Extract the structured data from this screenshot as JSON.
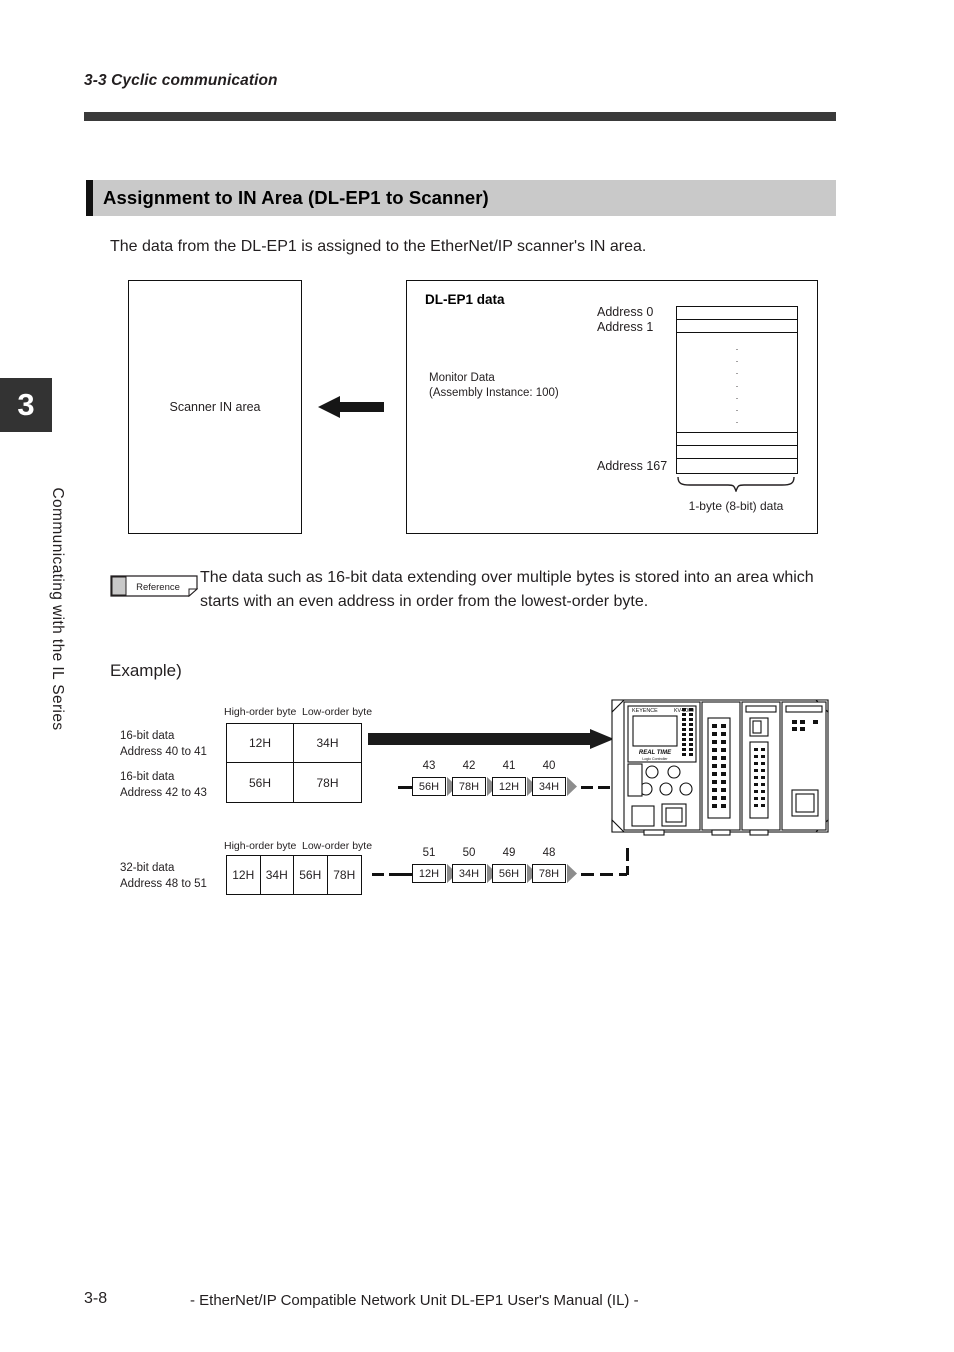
{
  "header": {
    "running_head": "3-3 Cyclic communication"
  },
  "sidebar": {
    "chapter_number": "3",
    "chapter_label": "Communicating with the IL Series"
  },
  "section": {
    "title": "Assignment to IN Area (DL-EP1 to Scanner)",
    "intro": "The data from the DL-EP1 is assigned to the EtherNet/IP scanner's IN area."
  },
  "diagram": {
    "scanner_box_label": "Scanner IN area",
    "dlep1_title": "DL-EP1 data",
    "monitor_line1": "Monitor Data",
    "monitor_line2": "(Assembly Instance: 100)",
    "address_first": "Address 0",
    "address_second": "Address 1",
    "address_last": "Address 167",
    "byte_caption": "1-byte (8-bit) data",
    "vertical_dots": ".\n.\n.\n.\n.\n.\n."
  },
  "reference": {
    "badge": "Reference",
    "text": "The data such as 16-bit data extending over multiple bytes is stored into an area which starts with an even address in order from the lowest-order byte."
  },
  "example": {
    "heading": "Example)",
    "header_high": "High-order byte",
    "header_low": "Low-order byte",
    "block16": {
      "row1_label_line1": "16-bit data",
      "row1_label_line2": "Address 40 to 41",
      "row2_label_line1": "16-bit data",
      "row2_label_line2": "Address 42 to 43",
      "cells": [
        "12H",
        "34H",
        "56H",
        "78H"
      ],
      "stream_addresses": [
        "43",
        "42",
        "41",
        "40"
      ],
      "stream_values": [
        "56H",
        "78H",
        "12H",
        "34H"
      ]
    },
    "block32": {
      "label_line1": "32-bit data",
      "label_line2": "Address 48 to 51",
      "cells": [
        "12H",
        "34H",
        "56H",
        "78H"
      ],
      "stream_addresses": [
        "51",
        "50",
        "49",
        "48"
      ],
      "stream_values": [
        "12H",
        "34H",
        "56H",
        "78H"
      ]
    },
    "device": {
      "brand": "KEYENCE",
      "model": "KV-5000",
      "display_line1": "REAL TIME",
      "display_line2": "Logic Controller"
    }
  },
  "footer": {
    "page_number": "3-8",
    "manual_title": "- EtherNet/IP Compatible Network Unit DL-EP1 User's Manual (IL) -"
  },
  "colors": {
    "rule": "#3a3a3a",
    "section_bg": "#c9c9c9",
    "accent": "#111111",
    "tab_bg": "#333333",
    "arrow_gray": "#9a9a9a"
  }
}
